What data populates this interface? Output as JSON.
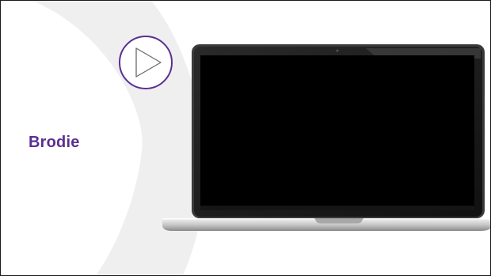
{
  "slide": {
    "title": "Brodie"
  },
  "icons": {
    "play": "play-icon",
    "laptop": "laptop-icon"
  },
  "colors": {
    "accent": "#5b2f91",
    "arc": "#efefef",
    "screen": "#000000",
    "frame_border": "#1a1a1a"
  }
}
